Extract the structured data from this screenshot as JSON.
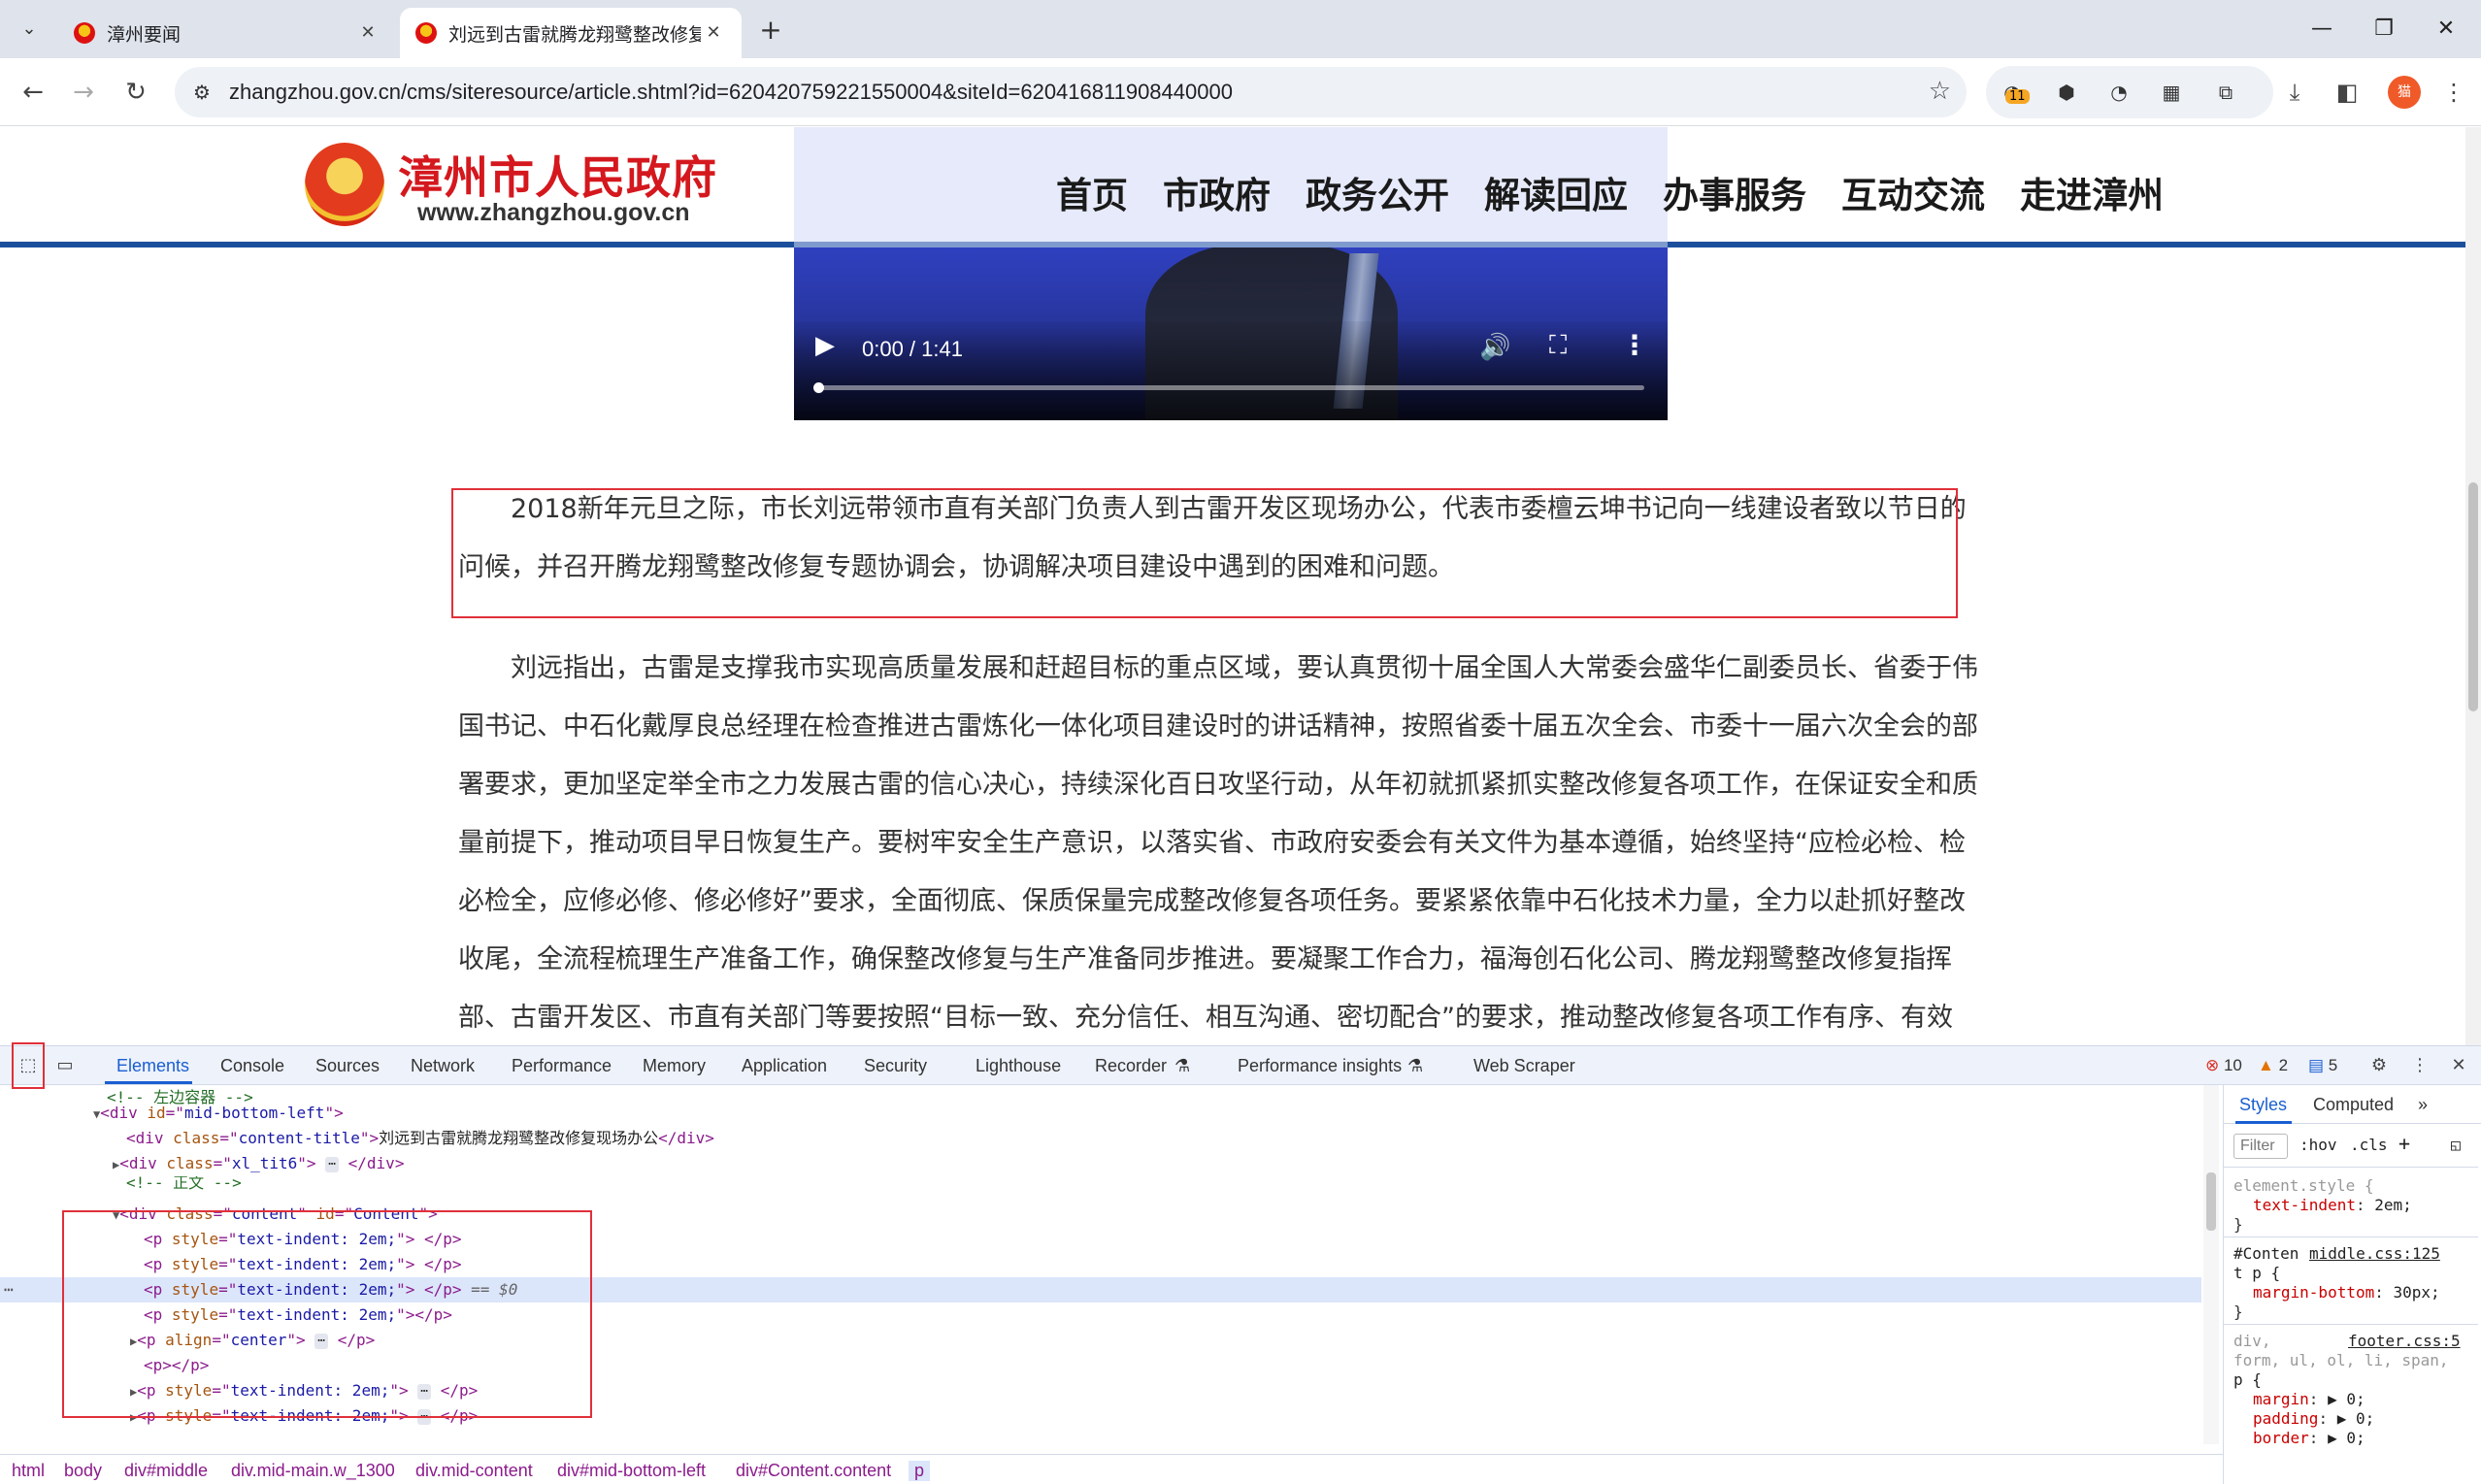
{
  "browser": {
    "tabs": [
      {
        "title": "漳州要闻",
        "active": false
      },
      {
        "title": "刘远到古雷就腾龙翔鹭整改修复",
        "active": true
      }
    ],
    "url": "zhangzhou.gov.cn/cms/siteresource/article.shtml?id=620420759221550004&siteId=620416811908440000",
    "extension_badge": "11",
    "profile_label": "猫"
  },
  "site": {
    "logo_text": "漳州市人民政府",
    "logo_domain": "www.zhangzhou.gov.cn",
    "nav": [
      "首页",
      "市政府",
      "政务公开",
      "解读回应",
      "办事服务",
      "互动交流",
      "走进漳州"
    ]
  },
  "video": {
    "time": "0:00 / 1:41",
    "progress": 0
  },
  "article": {
    "paragraphs": [
      "2018新年元旦之际，市长刘远带领市直有关部门负责人到古雷开发区现场办公，代表市委檀云坤书记向一线建设者致以节日的问候，并召开腾龙翔鹭整改修复专题协调会，协调解决项目建设中遇到的困难和问题。",
      "刘远指出，古雷是支撑我市实现高质量发展和赶超目标的重点区域，要认真贯彻十届全国人大常委会盛华仁副委员长、省委于伟国书记、中石化戴厚良总经理在检查推进古雷炼化一体化项目建设时的讲话精神，按照省委十届五次全会、市委十一届六次全会的部署要求，更加坚定举全市之力发展古雷的信心决心，持续深化百日攻坚行动，从年初就抓紧抓实整改修复各项工作，在保证安全和质量前提下，推动项目早日恢复生产。要树牢安全生产意识，以落实省、市政府安委会有关文件为基本遵循，始终坚持“应检必检、检必检全，应修必修、修必修好”要求，全面彻底、保质保量完成整改修复各项任务。要紧紧依靠中石化技术力量，全力以赴抓好整改收尾，全流程梳理生产准备工作，确保整改修复与生产准备同步推进。要凝聚工作合力，福海创石化公司、腾龙翔鹭整改修复指挥部、古雷开发区、市直有关部门等要按照“目标一致、充分信任、相互沟通、密切配合”的要求，推动整改修复各项工作有序、有效"
    ]
  },
  "devtools": {
    "tabs": [
      "Elements",
      "Console",
      "Sources",
      "Network",
      "Performance",
      "Memory",
      "Application",
      "Security",
      "Lighthouse",
      "Recorder",
      "Performance insights",
      "Web Scraper"
    ],
    "errors": "10",
    "warnings": "2",
    "messages": "5",
    "dom": {
      "comment_left": "<!-- 左边容器 -->",
      "div_mid_bottom_left": "mid-bottom-left",
      "content_title_class": "content-title",
      "content_title_text": "刘远到古雷就腾龙翔鹭整改修复现场办公",
      "xl_tit_class": "xl_tit6",
      "comment_body": "<!-- 正文 -->",
      "content_class": "content",
      "content_id": "Content",
      "p_style": "text-indent: 2em;",
      "p_align": "center",
      "selected_marker": "== $0"
    },
    "breadcrumbs": [
      "html",
      "body",
      "div#middle",
      "div.mid-main.w_1300",
      "div.mid-content",
      "div#mid-bottom-left",
      "div#Content.content",
      "p"
    ],
    "styles": {
      "tabs": [
        "Styles",
        "Computed"
      ],
      "filter_placeholder": "Filter",
      "hov": ":hov",
      "cls": ".cls",
      "element_style_selector": "element.style {",
      "element_style_prop": "text-indent",
      "element_style_val": "2em;",
      "rule2_selector_a": "#Conten",
      "rule2_selector_b": "t p {",
      "rule2_source": "middle.css:125",
      "rule2_prop": "margin-bottom",
      "rule2_val": "30px;",
      "rule3_selector_a": "div,",
      "rule3_source": "footer.css:5",
      "rule3_selector_b": "form, ul, ol, li, span,",
      "rule3_selector_c": "p {",
      "rule3_props": [
        {
          "prop": "margin",
          "val": "▶ 0;"
        },
        {
          "prop": "padding",
          "val": "▶ 0;"
        },
        {
          "prop": "border",
          "val": "▶ 0;"
        }
      ],
      "close_brace": "}"
    }
  }
}
